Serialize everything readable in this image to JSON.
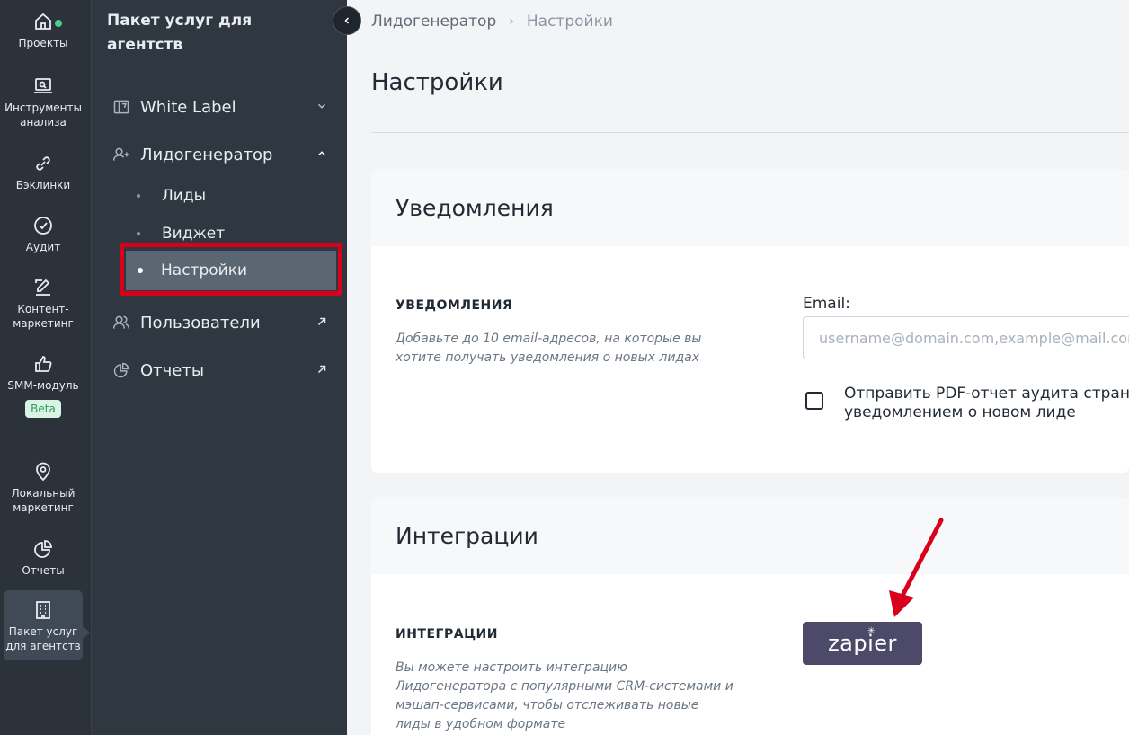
{
  "rail": {
    "items": [
      {
        "label": "Проекты",
        "icon": "home-icon"
      },
      {
        "label": "Инструменты анализа",
        "icon": "laptop-search-icon"
      },
      {
        "label": "Бэклинки",
        "icon": "link-icon"
      },
      {
        "label": "Аудит",
        "icon": "check-circle-icon"
      },
      {
        "label": "Контент-маркетинг",
        "icon": "edit-icon"
      },
      {
        "label": "SMM-модуль",
        "icon": "thumbs-up-icon",
        "badge": "Beta"
      },
      {
        "label": "Локальный маркетинг",
        "icon": "location-pin-icon"
      },
      {
        "label": "Отчеты",
        "icon": "pie-chart-icon"
      },
      {
        "label": "Пакет услуг для агентств",
        "icon": "building-icon"
      }
    ]
  },
  "sidebar": {
    "title": "Пакет услуг для агентств",
    "menu": [
      {
        "label": "White Label",
        "icon": "white-label-icon",
        "right": "chevron-down-icon"
      },
      {
        "label": "Лидогенератор",
        "icon": "user-plus-icon",
        "right": "chevron-up-icon"
      },
      {
        "label": "Пользователи",
        "icon": "users-icon",
        "right": "external-arrow-icon"
      },
      {
        "label": "Отчеты",
        "icon": "pie-chart-icon",
        "right": "external-arrow-icon"
      }
    ],
    "submenu": [
      "Лиды",
      "Виджет",
      "Настройки"
    ]
  },
  "breadcrumb": {
    "parent": "Лидогенератор",
    "current": "Настройки"
  },
  "page": {
    "title": "Настройки"
  },
  "notifications": {
    "header": "Уведомления",
    "label": "УВЕДОМЛЕНИЯ",
    "description": "Добавьте до 10 email-адресов, на которые вы хотите получать уведомления о новых лидах",
    "email_label": "Email:",
    "email_placeholder": "username@domain.com,example@mail.com",
    "checkbox_line1": "Отправить PDF-отчет аудита страницы с",
    "checkbox_line2": "уведомлением о новом лиде",
    "checkbox_checked": false
  },
  "integrations": {
    "header": "Интеграции",
    "label": "ИНТЕГРАЦИИ",
    "description": "Вы можете настроить интеграцию Лидогенератора с популярными CRM-системами и мэшап-сервисами, чтобы отслеживать новые лиды в удобном формате",
    "zapier_label": "zapier"
  },
  "colors": {
    "annotation_red": "#d9001b",
    "zapier_bg": "#4c4969",
    "rail_bg": "#2b323a",
    "sidebar_bg": "#2f3740"
  }
}
